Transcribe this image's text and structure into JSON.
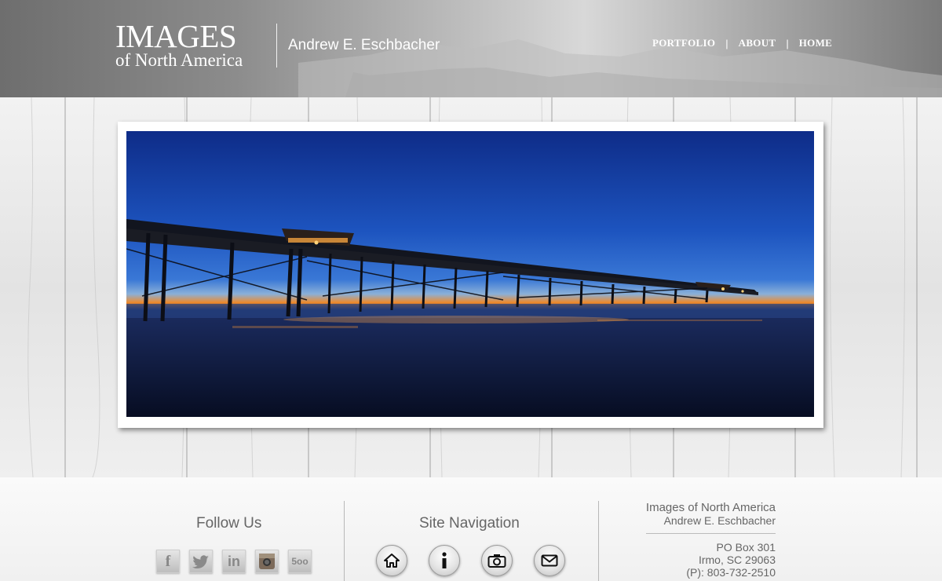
{
  "header": {
    "logo_main": "IMAGES",
    "logo_sub": "of North America",
    "photographer": "Andrew E. Eschbacher",
    "nav": [
      {
        "label": "PORTFOLIO"
      },
      {
        "label": "ABOUT"
      },
      {
        "label": "HOME"
      }
    ],
    "nav_separator": "|"
  },
  "hero": {
    "alt": "Pier at sunset on the beach"
  },
  "footer": {
    "follow_title": "Follow Us",
    "social": [
      {
        "icon": "facebook-icon",
        "glyph": "f"
      },
      {
        "icon": "twitter-icon",
        "glyph": "t"
      },
      {
        "icon": "linkedin-icon",
        "glyph": "in"
      },
      {
        "icon": "instagram-icon",
        "glyph": ""
      },
      {
        "icon": "500px-icon",
        "glyph": "5oo"
      }
    ],
    "site_nav_title": "Site Navigation",
    "site_nav": [
      {
        "icon": "home-icon"
      },
      {
        "icon": "info-icon"
      },
      {
        "icon": "camera-icon"
      },
      {
        "icon": "mail-icon"
      }
    ],
    "contact": {
      "company": "Images of North America",
      "name": "Andrew E. Eschbacher",
      "po_box": "PO Box 301",
      "city": "Irmo, SC 29063",
      "phone": "(P): 803-732-2510"
    }
  },
  "colors": {
    "header_dark": "#6e6e6e",
    "header_light": "#d8d8d8",
    "text_gray": "#666666",
    "sky_top": "#10389a",
    "sunset": "#f08a2a"
  }
}
